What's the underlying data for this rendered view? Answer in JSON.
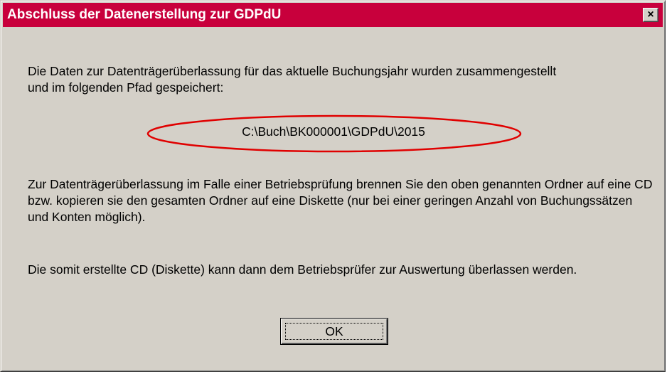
{
  "window": {
    "title": "Abschluss der Datenerstellung zur GDPdU",
    "close_label": "×",
    "titlebar_color": "#c8003c"
  },
  "message": {
    "intro": "Die Daten zur Datenträgerüberlassung für das aktuelle Buchungsjahr wurden zusammengestellt und im folgenden Pfad gespeichert:",
    "path": "C:\\Buch\\BK000001\\GDPdU\\2015",
    "instructions": "Zur Datenträgerüberlassung im Falle einer Betriebsprüfung brennen Sie den oben genannten Ordner auf eine CD bzw. kopieren sie den gesamten Ordner auf eine Diskette (nur bei einer geringen Anzahl von Buchungssätzen und Konten möglich).",
    "closing": "Die somit erstellte CD (Diskette) kann dann dem Betriebsprüfer zur Auswertung überlassen werden."
  },
  "buttons": {
    "ok_label": "OK"
  },
  "annotation": {
    "highlight_color": "#e00000"
  }
}
